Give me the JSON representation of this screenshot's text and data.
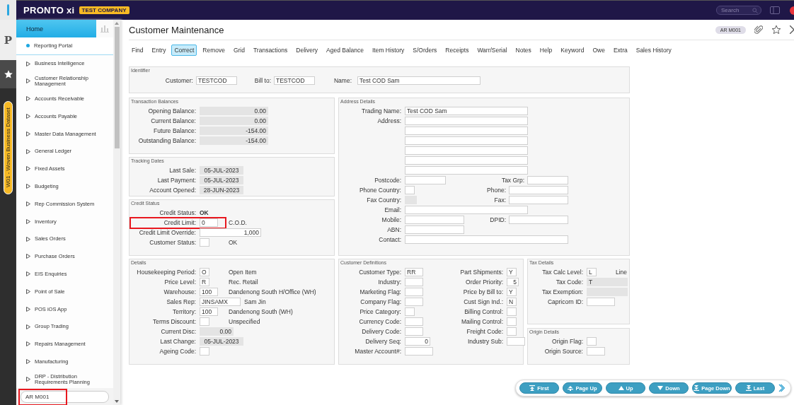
{
  "rail": {
    "logo": "P",
    "badge": "W01 - Woven Business Dataset"
  },
  "topbar": {
    "logo": "PRONTO xi",
    "company": "TEST COMPANY",
    "search": {
      "placeholder": "Search"
    }
  },
  "sidebar": {
    "home": "Home",
    "items": [
      {
        "label": "Reporting Portal",
        "kind": "link",
        "selected": true
      },
      {
        "label": "Business Intelligence",
        "kind": "folder",
        "selected": false
      },
      {
        "label": "Customer Relationship Management",
        "kind": "folder",
        "selected": false
      },
      {
        "label": "Accounts Receivable",
        "kind": "folder",
        "selected": false
      },
      {
        "label": "Accounts Payable",
        "kind": "folder",
        "selected": false
      },
      {
        "label": "Master Data Management",
        "kind": "folder",
        "selected": false
      },
      {
        "label": "General Ledger",
        "kind": "folder",
        "selected": false
      },
      {
        "label": "Fixed Assets",
        "kind": "folder",
        "selected": false
      },
      {
        "label": "Budgeting",
        "kind": "folder",
        "selected": false
      },
      {
        "label": "Rep Commission System",
        "kind": "folder",
        "selected": false
      },
      {
        "label": "Inventory",
        "kind": "folder",
        "selected": false
      },
      {
        "label": "Sales Orders",
        "kind": "folder",
        "selected": false
      },
      {
        "label": "Purchase Orders",
        "kind": "folder",
        "selected": false
      },
      {
        "label": "EIS Enquiries",
        "kind": "folder",
        "selected": false
      },
      {
        "label": "Point of Sale",
        "kind": "folder",
        "selected": false
      },
      {
        "label": "POS iOS App",
        "kind": "folder",
        "selected": false
      },
      {
        "label": "Group Trading",
        "kind": "folder",
        "selected": false
      },
      {
        "label": "Repairs Management",
        "kind": "folder",
        "selected": false
      },
      {
        "label": "Manufacturing",
        "kind": "folder",
        "selected": false
      },
      {
        "label": "DRP - Distribution Requirements Planning",
        "kind": "folder",
        "selected": false
      }
    ],
    "search": {
      "value": "AR M001",
      "highlighted": true
    }
  },
  "page": {
    "title": "Customer Maintenance",
    "code": "AR M001"
  },
  "menu": [
    {
      "label": "Find",
      "selected": false
    },
    {
      "label": "Entry",
      "selected": false
    },
    {
      "label": "Correct",
      "selected": true
    },
    {
      "label": "Remove",
      "selected": false
    },
    {
      "label": "Grid",
      "selected": false
    },
    {
      "label": "Transactions",
      "selected": false
    },
    {
      "label": "Delivery",
      "selected": false
    },
    {
      "label": "Aged Balance",
      "selected": false
    },
    {
      "label": "Item History",
      "selected": false
    },
    {
      "label": "S/Orders",
      "selected": false
    },
    {
      "label": "Receipts",
      "selected": false
    },
    {
      "label": "Warr/Serial",
      "selected": false
    },
    {
      "label": "Notes",
      "selected": false
    },
    {
      "label": "Help",
      "selected": false
    },
    {
      "label": "Keyword",
      "selected": false
    },
    {
      "label": "Owe",
      "selected": false
    },
    {
      "label": "Extra",
      "selected": false
    },
    {
      "label": "Sales History",
      "selected": false
    }
  ],
  "identifier": {
    "title": "Identifier",
    "fields": [
      {
        "label": "Customer:",
        "value": "TESTCOD"
      },
      {
        "label": "Bill to:",
        "value": "TESTCOD"
      },
      {
        "label": "Name:",
        "value": "Test COD Sam"
      }
    ]
  },
  "transaction_balances": {
    "title": "Transaction Balances",
    "columns": [
      [
        {
          "label": "Opening Balance:",
          "kind": "amount",
          "value": "0.00"
        },
        {
          "label": "Current Balance:",
          "kind": "amount",
          "value": "0.00"
        },
        {
          "label": "Future Balance:",
          "kind": "amount",
          "value": "-154.00"
        },
        {
          "label": "Outstanding Balance:",
          "kind": "amount",
          "value": "-154.00"
        }
      ]
    ]
  },
  "tracking_dates": {
    "title": "Tracking Dates",
    "columns": [
      [
        {
          "label": "Last Sale:",
          "kind": "date",
          "value": "05-JUL-2023"
        },
        {
          "label": "Last Payment:",
          "kind": "date",
          "value": "05-JUL-2023"
        },
        {
          "label": "Account Opened:",
          "kind": "date",
          "value": "28-JUN-2023"
        }
      ]
    ]
  },
  "credit_status": {
    "title": "Credit Status",
    "columns": [
      [
        {
          "label": "Credit Status:",
          "kind": "text",
          "value": "OK",
          "highlighted": false
        },
        {
          "label": "Credit Limit:",
          "kind": "code",
          "value": "0",
          "note": "C.O.D.",
          "highlighted": true
        },
        {
          "label": "Credit Limit Override:",
          "kind": "number",
          "value": "1,000",
          "highlighted": false
        },
        {
          "label": "Customer Status:",
          "kind": "flag",
          "note": "OK",
          "highlighted": false
        }
      ]
    ]
  },
  "address_details": {
    "title": "Address Details",
    "columns": [
      [
        {
          "label": "Trading Name:",
          "kind": "long",
          "value": "Test COD Sam"
        },
        {
          "label": "Address:",
          "kind": "long"
        },
        {
          "kind": "long"
        },
        {
          "kind": "long"
        },
        {
          "kind": "long"
        },
        {
          "kind": "long"
        },
        {
          "kind": "long"
        },
        {
          "label": "Postcode:",
          "kind": "input",
          "pair": {
            "label": "Tax Grp:",
            "kind": "input"
          }
        },
        {
          "label": "Phone Country:",
          "kind": "flag",
          "pair": {
            "label": "Phone:",
            "kind": "mid"
          }
        },
        {
          "label": "Fax Country:",
          "kind": "rflag",
          "pair": {
            "label": "Fax:",
            "kind": "mid"
          }
        },
        {
          "label": "Email:",
          "kind": "long"
        },
        {
          "label": "Mobile:",
          "kind": "mid",
          "pair": {
            "label": "DPID:",
            "kind": "mid"
          }
        },
        {
          "label": "ABN:",
          "kind": "mid"
        },
        {
          "label": "Contact:",
          "kind": "wide"
        }
      ]
    ]
  },
  "details": {
    "title": "Details",
    "columns": [
      [
        {
          "label": "Housekeeping Period:",
          "kind": "flag",
          "value": "O",
          "note": "Open Item"
        },
        {
          "label": "Price Level:",
          "kind": "flag",
          "value": "R",
          "note": "Rec. Retail"
        },
        {
          "label": "Warehouse:",
          "kind": "code",
          "value": "100",
          "note": "Dandenong South H/Office (WH)"
        },
        {
          "label": "Sales Rep:",
          "kind": "input",
          "value": "JINSAMX",
          "note": "Sam Jin"
        },
        {
          "label": "Territory:",
          "kind": "code",
          "value": "100",
          "note": "Dandenong South (WH)"
        },
        {
          "label": "Terms Discount:",
          "kind": "flag",
          "note": "Unspecified"
        },
        {
          "label": "Current Disc:",
          "kind": "disc",
          "value": "0.00"
        },
        {
          "label": "Last Change:",
          "kind": "date",
          "value": "05-JUL-2023"
        },
        {
          "label": "Ageing Code:",
          "kind": "flag"
        }
      ]
    ]
  },
  "customer_definitions": {
    "title": "Customer Definitions",
    "columns": [
      [
        {
          "label": "Customer Type:",
          "kind": "code",
          "value": "RR"
        },
        {
          "label": "Industry:",
          "kind": "code"
        },
        {
          "label": "Marketing Flag:",
          "kind": "code"
        },
        {
          "label": "Company Flag:",
          "kind": "code"
        },
        {
          "label": "Price Category:",
          "kind": "flag"
        },
        {
          "label": "Currency Code:",
          "kind": "code"
        },
        {
          "label": "Delivery Code:",
          "kind": "code"
        },
        {
          "label": "Delivery Seq:",
          "kind": "ncode",
          "value": "0"
        },
        {
          "label": "Master Account#:",
          "kind": "acct"
        }
      ],
      [
        {
          "label": "Part Shipments:",
          "kind": "flag",
          "value": "Y"
        },
        {
          "label": "Order Priority:",
          "kind": "nflag",
          "value": "5"
        },
        {
          "label": "Price by Bill to:",
          "kind": "flag",
          "value": "Y"
        },
        {
          "label": "Cust Sign Ind.:",
          "kind": "flag",
          "value": "N"
        },
        {
          "label": "Billing Control:",
          "kind": "flag"
        },
        {
          "label": "Mailing Control:",
          "kind": "flag"
        },
        {
          "label": "Freight Code:",
          "kind": "flag"
        },
        {
          "label": "Industry Sub:",
          "kind": "code"
        }
      ]
    ]
  },
  "tax_details": {
    "title": "Tax Details",
    "columns": [
      [
        {
          "label": "Tax Calc Level:",
          "kind": "flag",
          "value": "L",
          "note": "Line"
        },
        {
          "label": "Tax Code:",
          "kind": "rwide",
          "value": "T"
        },
        {
          "label": "Tax Exemption:",
          "kind": "rwide"
        },
        {
          "label": "Capricorn ID:",
          "kind": "acct"
        }
      ]
    ]
  },
  "origin_details": {
    "title": "Origin Details",
    "columns": [
      [
        {
          "label": "Origin Flag:",
          "kind": "flag"
        },
        {
          "label": "Origin Source:",
          "kind": "code"
        }
      ]
    ]
  },
  "nav": [
    {
      "label": "First",
      "kind": "first"
    },
    {
      "label": "Page Up",
      "kind": "page_up"
    },
    {
      "label": "Up",
      "kind": "up"
    },
    {
      "label": "Down",
      "kind": "down"
    },
    {
      "label": "Page Down",
      "kind": "page_down"
    },
    {
      "label": "Last",
      "kind": "last"
    }
  ]
}
